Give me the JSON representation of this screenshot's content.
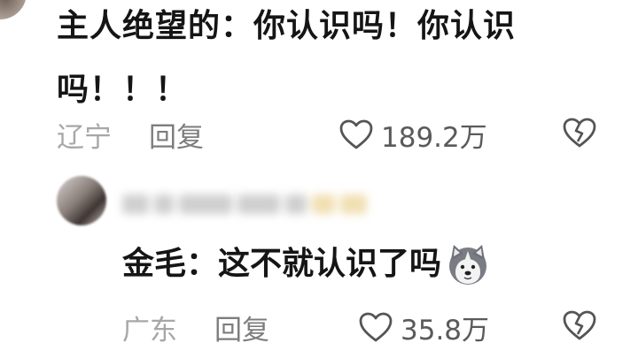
{
  "comment1": {
    "text": "主人绝望的：你认识吗！你认识吗！！！",
    "location": "辽宁",
    "reply_label": "回复",
    "likes": "189.2万"
  },
  "reply1": {
    "text": "金毛：这不就认识了吗",
    "emoji": "husky-dog-emoji",
    "location": "广东",
    "reply_label": "回复",
    "likes": "35.8万"
  },
  "icons": {
    "like": "heart-outline-icon",
    "dislike": "broken-heart-icon"
  },
  "colors": {
    "text": "#151515",
    "meta": "#8c8c8c",
    "background": "#ffffff"
  }
}
